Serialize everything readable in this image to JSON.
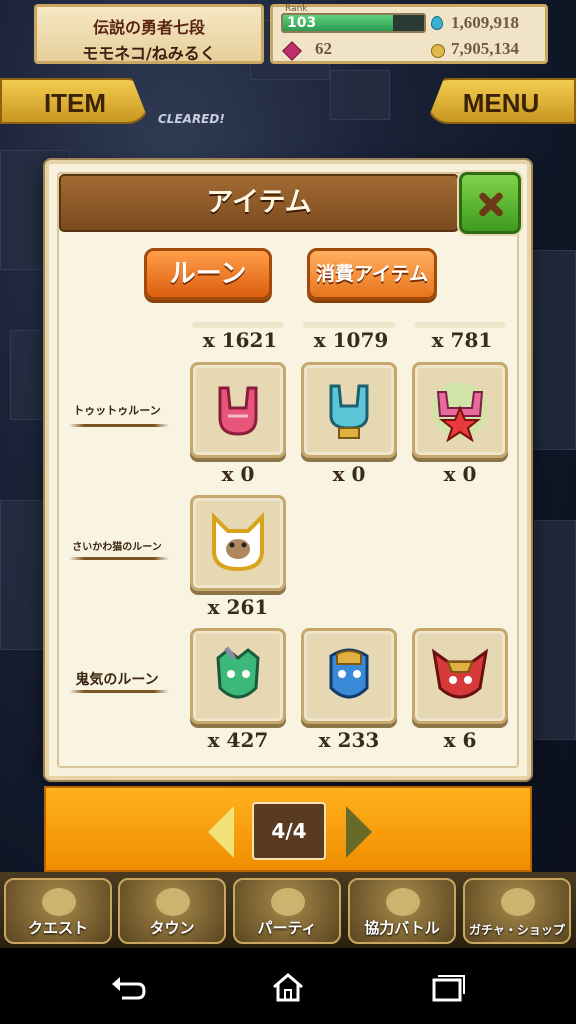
{
  "hud": {
    "player_title": "伝説の勇者七段",
    "player_name": "モモネコ/ねみるく",
    "rank_label": "Rank",
    "rank": "103",
    "rank_progress": 0.78,
    "gems": "62",
    "stamina_currency": "1,609,918",
    "gold": "7,905,134"
  },
  "nav_tabs": {
    "item": "ITEM",
    "menu": "MENU"
  },
  "map_text": "CLEARED!",
  "modal": {
    "title": "アイテム",
    "close_icon": "close-x-icon",
    "tabs": {
      "rune": "ルーン",
      "consumable": "消費アイテム"
    },
    "top_quantities": [
      "x 1621",
      "x 1079",
      "x 781"
    ],
    "rows": [
      {
        "label": "トゥットゥルーン",
        "items": [
          {
            "icon": "pink-horns-hand-rune",
            "qty": "x 0"
          },
          {
            "icon": "blue-horns-hand-rune",
            "qty": "x 0"
          },
          {
            "icon": "rainbow-star-hands-rune",
            "qty": "x 0"
          }
        ]
      },
      {
        "label": "さいかわ猫のルーン",
        "items": [
          {
            "icon": "cat-face-rune",
            "qty": "x 261"
          }
        ]
      },
      {
        "label": "鬼気のルーン",
        "items": [
          {
            "icon": "green-oni-mask-rune",
            "qty": "x 427"
          },
          {
            "icon": "blue-oni-mask-rune",
            "qty": "x 233"
          },
          {
            "icon": "red-oni-mask-rune",
            "qty": "x 6"
          }
        ]
      }
    ]
  },
  "pager": {
    "page": "4/4"
  },
  "bottom_nav": [
    "クエスト",
    "タウン",
    "パーティ",
    "協力バトル",
    "ガチャ・ショップ"
  ],
  "colors": {
    "accent_orange": "#f08d00",
    "header_brown": "#7b4a1d",
    "close_green": "#3f9a1e"
  }
}
